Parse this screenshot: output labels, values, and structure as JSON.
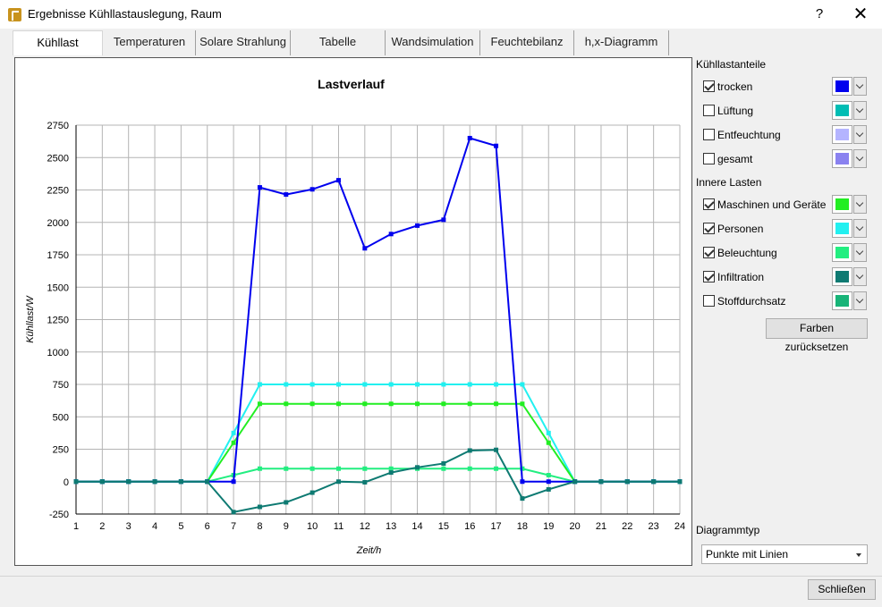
{
  "window": {
    "title": "Ergebnisse Kühllastauslegung, Raum",
    "help_glyph": "?",
    "close_glyph": "✕"
  },
  "tabs": [
    {
      "label": "Kühllast",
      "active": true
    },
    {
      "label": "Temperaturen"
    },
    {
      "label": "Solare Strahlung"
    },
    {
      "label": "Tabelle"
    },
    {
      "label": "Wandsimulation"
    },
    {
      "label": "Feuchtebilanz"
    },
    {
      "label": "h,x-Diagramm"
    }
  ],
  "panel": {
    "group1_label": "Kühllastanteile",
    "group1": [
      {
        "label": "trocken",
        "checked": true,
        "color": "#0000ee"
      },
      {
        "label": "Lüftung",
        "checked": false,
        "color": "#00bdb4"
      },
      {
        "label": "Entfeuchtung",
        "checked": false,
        "color": "#b4b4ff"
      },
      {
        "label": "gesamt",
        "checked": false,
        "color": "#8a82f0"
      }
    ],
    "group2_label": "Innere Lasten",
    "group2": [
      {
        "label": "Maschinen und Geräte",
        "checked": true,
        "color": "#22ee22"
      },
      {
        "label": "Personen",
        "checked": true,
        "color": "#22f0f0"
      },
      {
        "label": "Beleuchtung",
        "checked": true,
        "color": "#22ee80"
      },
      {
        "label": "Infiltration",
        "checked": true,
        "color": "#0e7a72"
      },
      {
        "label": "Stoffdurchsatz",
        "checked": false,
        "color": "#18b478"
      }
    ],
    "reset_label": "Farben zurücksetzen",
    "diagram_type_label": "Diagrammtyp",
    "diagram_type_value": "Punkte mit Linien"
  },
  "footer": {
    "close_label": "Schließen"
  },
  "chart_data": {
    "type": "line",
    "title": "Lastverlauf",
    "xlabel": "Zeit/h",
    "ylabel": "Kühllast/W",
    "xlim": [
      1,
      24
    ],
    "ylim": [
      -250,
      2750
    ],
    "xticks": [
      1,
      2,
      3,
      4,
      5,
      6,
      7,
      8,
      9,
      10,
      11,
      12,
      13,
      14,
      15,
      16,
      17,
      18,
      19,
      20,
      21,
      22,
      23,
      24
    ],
    "yticks": [
      -250,
      0,
      250,
      500,
      750,
      1000,
      1250,
      1500,
      1750,
      2000,
      2250,
      2500,
      2750
    ],
    "grid": true,
    "x": [
      1,
      2,
      3,
      4,
      5,
      6,
      7,
      8,
      9,
      10,
      11,
      12,
      13,
      14,
      15,
      16,
      17,
      18,
      19,
      20,
      21,
      22,
      23,
      24
    ],
    "series": [
      {
        "name": "Personen",
        "color": "#22f0f0",
        "values": [
          0,
          0,
          0,
          0,
          0,
          0,
          375,
          750,
          750,
          750,
          750,
          750,
          750,
          750,
          750,
          750,
          750,
          750,
          375,
          0,
          0,
          0,
          0,
          0
        ]
      },
      {
        "name": "Maschinen und Geräte",
        "color": "#22ee22",
        "values": [
          0,
          0,
          0,
          0,
          0,
          0,
          300,
          600,
          600,
          600,
          600,
          600,
          600,
          600,
          600,
          600,
          600,
          600,
          300,
          0,
          0,
          0,
          0,
          0
        ]
      },
      {
        "name": "Beleuchtung",
        "color": "#22ee80",
        "values": [
          0,
          0,
          0,
          0,
          0,
          0,
          50,
          100,
          100,
          100,
          100,
          100,
          100,
          100,
          100,
          100,
          100,
          100,
          50,
          0,
          0,
          0,
          0,
          0
        ]
      },
      {
        "name": "trocken",
        "color": "#0000ee",
        "values": [
          0,
          0,
          0,
          0,
          0,
          0,
          0,
          2270,
          2215,
          2255,
          2325,
          1800,
          1910,
          1975,
          2020,
          2650,
          2590,
          0,
          0,
          0,
          0,
          0,
          0,
          0
        ]
      },
      {
        "name": "Infiltration",
        "color": "#0e7a72",
        "values": [
          0,
          0,
          0,
          0,
          0,
          0,
          -235,
          -195,
          -160,
          -85,
          0,
          -5,
          70,
          110,
          140,
          240,
          245,
          -130,
          -60,
          0,
          0,
          0,
          0,
          0
        ]
      }
    ]
  }
}
